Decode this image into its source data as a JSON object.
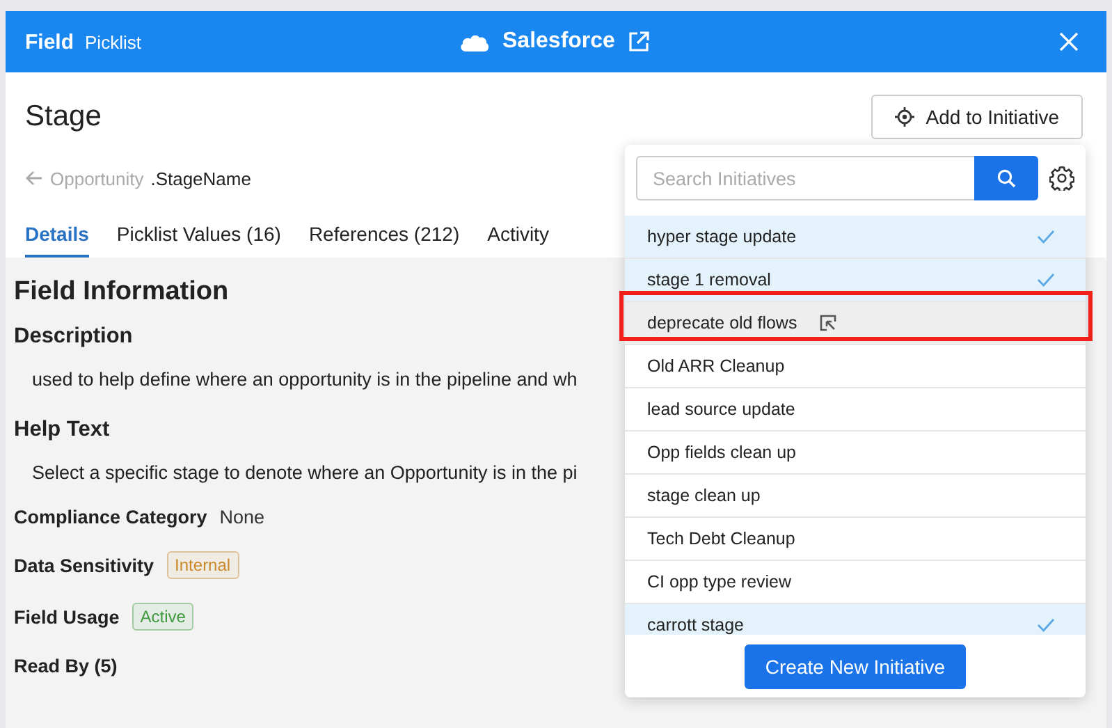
{
  "header": {
    "title": "Field",
    "subtitle": "Picklist",
    "app": "Salesforce"
  },
  "field": {
    "name": "Stage",
    "object": "Opportunity",
    "api_name": ".StageName"
  },
  "add_button": "Add to Initiative",
  "tabs": [
    {
      "label": "Details",
      "selected": true
    },
    {
      "label": "Picklist Values (16)",
      "selected": false
    },
    {
      "label": "References (212)",
      "selected": false
    },
    {
      "label": "Activity",
      "selected": false
    }
  ],
  "details": {
    "heading": "Field Information",
    "description_label": "Description",
    "description": "used to help define where an opportunity is in the pipeline and wh",
    "help_label": "Help Text",
    "help": "Select a specific stage to denote where an Opportunity is in the pi",
    "properties": [
      {
        "label": "Compliance Category",
        "value": "None",
        "kind": "text"
      },
      {
        "label": "Data Sensitivity",
        "value": "Internal",
        "kind": "tag",
        "color": "#c98a2b"
      },
      {
        "label": "Field Usage",
        "value": "Active",
        "kind": "tag",
        "color": "#3f9a3f"
      }
    ],
    "read_by": "Read By (5)"
  },
  "popup": {
    "search": {
      "placeholder": "Search Initiatives"
    },
    "initiatives": [
      {
        "name": "hyper stage update",
        "selected": true,
        "hovered": false
      },
      {
        "name": "stage 1 removal",
        "selected": true,
        "hovered": false
      },
      {
        "name": "deprecate old flows",
        "selected": false,
        "hovered": true
      },
      {
        "name": "Old ARR Cleanup",
        "selected": false,
        "hovered": false
      },
      {
        "name": "lead source update",
        "selected": false,
        "hovered": false
      },
      {
        "name": "Opp fields clean up",
        "selected": false,
        "hovered": false
      },
      {
        "name": "stage clean up",
        "selected": false,
        "hovered": false
      },
      {
        "name": "Tech Debt Cleanup",
        "selected": false,
        "hovered": false
      },
      {
        "name": "CI opp type review",
        "selected": false,
        "hovered": false
      },
      {
        "name": "carrott stage",
        "selected": true,
        "hovered": false
      }
    ],
    "create_button": "Create New Initiative"
  }
}
